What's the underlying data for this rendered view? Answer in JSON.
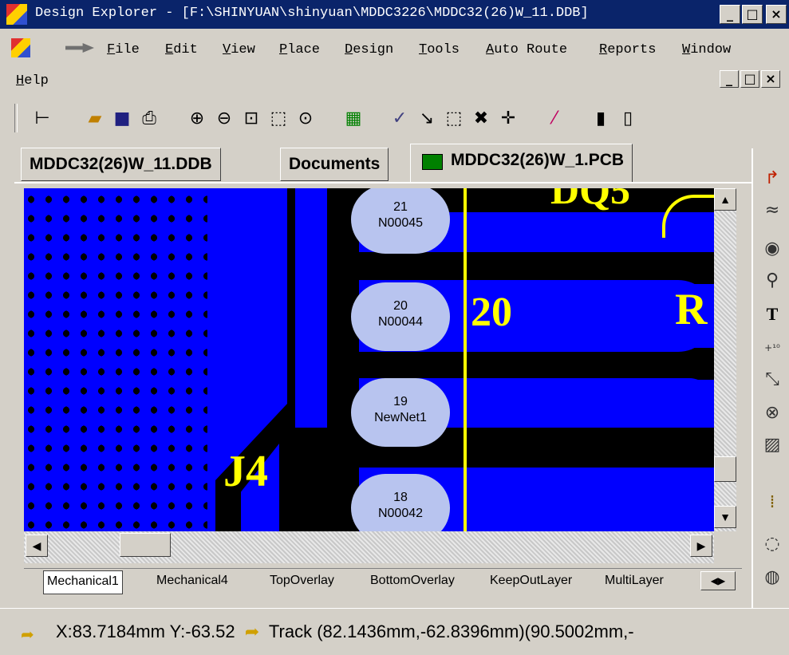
{
  "window": {
    "title": "Design Explorer - [F:\\SHINYUAN\\shinyuan\\MDDC3226\\MDDC32(26)W_11.DDB]",
    "min_label": "_",
    "max_label": "□",
    "close_label": "×"
  },
  "menu": {
    "items": [
      {
        "label": "File",
        "hotkey": "F"
      },
      {
        "label": "Edit",
        "hotkey": "E"
      },
      {
        "label": "View",
        "hotkey": "V"
      },
      {
        "label": "Place",
        "hotkey": "P"
      },
      {
        "label": "Design",
        "hotkey": "D"
      },
      {
        "label": "Tools",
        "hotkey": "T"
      },
      {
        "label": "Auto Route",
        "hotkey": "A"
      },
      {
        "label": "Reports",
        "hotkey": "R"
      },
      {
        "label": "Window",
        "hotkey": "W"
      },
      {
        "label": "Help",
        "hotkey": "H"
      }
    ]
  },
  "tabs": [
    {
      "label": "MDDC32(26)W_11.DDB"
    },
    {
      "label": "Documents"
    },
    {
      "label": "MDDC32(26)W_1.PCB"
    }
  ],
  "pcb": {
    "pads": [
      {
        "number": "21",
        "net": "N00045"
      },
      {
        "number": "20",
        "net": "N00044"
      },
      {
        "number": "19",
        "net": "NewNet1"
      },
      {
        "number": "18",
        "net": "N00042"
      }
    ],
    "silk_labels": {
      "ref_j4": "J4",
      "pin_20": "20",
      "top_text": "DQ5",
      "right_text": "R"
    },
    "colors": {
      "copper": "#0000ff",
      "board": "#000000",
      "silk": "#ffff00",
      "pad": "#b8c4ef"
    }
  },
  "layers": [
    "Mechanical1",
    "Mechanical4",
    "TopOverlay",
    "BottomOverlay",
    "KeepOutLayer",
    "MultiLayer"
  ],
  "status": {
    "coords": "X:83.7184mm Y:-63.52",
    "track": "Track (82.1436mm,-62.8396mm)(90.5002mm,-"
  }
}
